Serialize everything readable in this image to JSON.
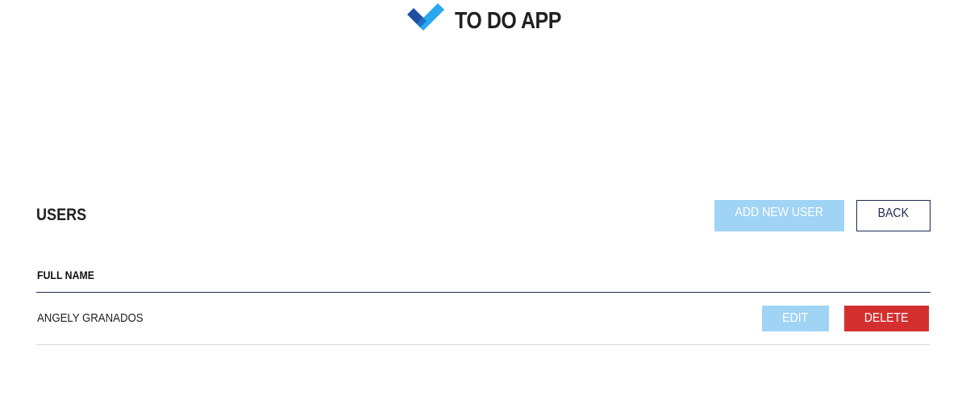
{
  "header": {
    "logo_icon": "checkmark-icon",
    "title": "TO DO APP",
    "colors": {
      "check_dark": "#1e4fa0",
      "check_light": "#2aa9f0"
    }
  },
  "users_section": {
    "title": "USERS",
    "add_button_label": "ADD NEW USER",
    "back_button_label": "BACK",
    "table": {
      "columns": [
        "FULL NAME"
      ],
      "rows": [
        {
          "full_name": "ANGELY GRANADOS",
          "edit_label": "EDIT",
          "delete_label": "DELETE"
        }
      ]
    }
  },
  "colors": {
    "primary_light": "#a0d4f5",
    "danger": "#d32f2f",
    "navy": "#1d2b4f",
    "divider": "#d9d9d9"
  }
}
